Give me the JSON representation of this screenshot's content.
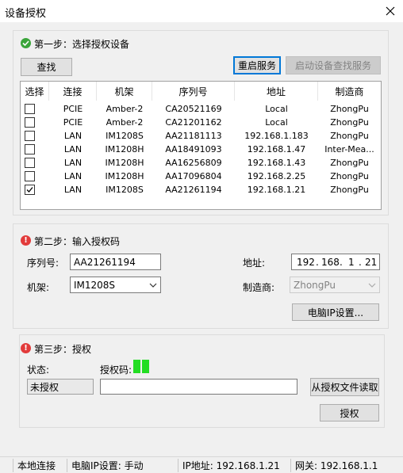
{
  "window": {
    "title": "设备授权"
  },
  "step1": {
    "title": "第一步：选择授权设备",
    "find_label": "查找",
    "restart_label": "重启服务",
    "start_find_label": "启动设备查找服务",
    "columns": [
      "选择",
      "连接",
      "机架",
      "序列号",
      "地址",
      "制造商"
    ],
    "rows": [
      {
        "checked": false,
        "conn": "PCIE",
        "rack": "Amber-2",
        "serial": "CA20521169",
        "addr": "Local",
        "vendor": "ZhongPu"
      },
      {
        "checked": false,
        "conn": "PCIE",
        "rack": "Amber-2",
        "serial": "CA21201162",
        "addr": "Local",
        "vendor": "ZhongPu"
      },
      {
        "checked": false,
        "conn": "LAN",
        "rack": "IM1208S",
        "serial": "AA21181113",
        "addr": "192.168.1.183",
        "vendor": "ZhongPu"
      },
      {
        "checked": false,
        "conn": "LAN",
        "rack": "IM1208H",
        "serial": "AA18491093",
        "addr": "192.168.1.47",
        "vendor": "Inter-Mea..."
      },
      {
        "checked": false,
        "conn": "LAN",
        "rack": "IM1208H",
        "serial": "AA16256809",
        "addr": "192.168.1.43",
        "vendor": "ZhongPu"
      },
      {
        "checked": false,
        "conn": "LAN",
        "rack": "IM1208H",
        "serial": "AA17096804",
        "addr": "192.168.2.25",
        "vendor": "ZhongPu"
      },
      {
        "checked": true,
        "conn": "LAN",
        "rack": "IM1208S",
        "serial": "AA21261194",
        "addr": "192.168.1.21",
        "vendor": "ZhongPu"
      }
    ]
  },
  "step2": {
    "title": "第二步：输入授权码",
    "serial_label": "序列号:",
    "serial_value": "AA21261194",
    "addr_label": "地址:",
    "ip": [
      "192",
      "168",
      "1",
      "21"
    ],
    "ip_sep": ".",
    "rack_label": "机架:",
    "rack_value": "IM1208S",
    "vendor_label": "制造商:",
    "vendor_value": "ZhongPu",
    "pc_ip_label": "电脑IP设置..."
  },
  "step3": {
    "title": "第三步：授权",
    "status_label": "状态:",
    "code_label": "授权码:",
    "status_value": "未授权",
    "code_value": "",
    "read_file_label": "从授权文件读取",
    "authorize_label": "授权"
  },
  "statusbar": {
    "conn": "本地连接",
    "pc_ip": "电脑IP设置: 手动",
    "ip": "IP地址: 192.168.1.21",
    "gateway": "网关: 192.168.1.1"
  },
  "colors": {
    "ok": "#3aa53a",
    "warn": "#e23b3b",
    "led": "#22dd22",
    "accent": "#0078d7"
  },
  "icons": {
    "step1": "check-shield-icon",
    "step2": "alert-icon",
    "step3": "alert-icon",
    "close": "close-icon"
  }
}
